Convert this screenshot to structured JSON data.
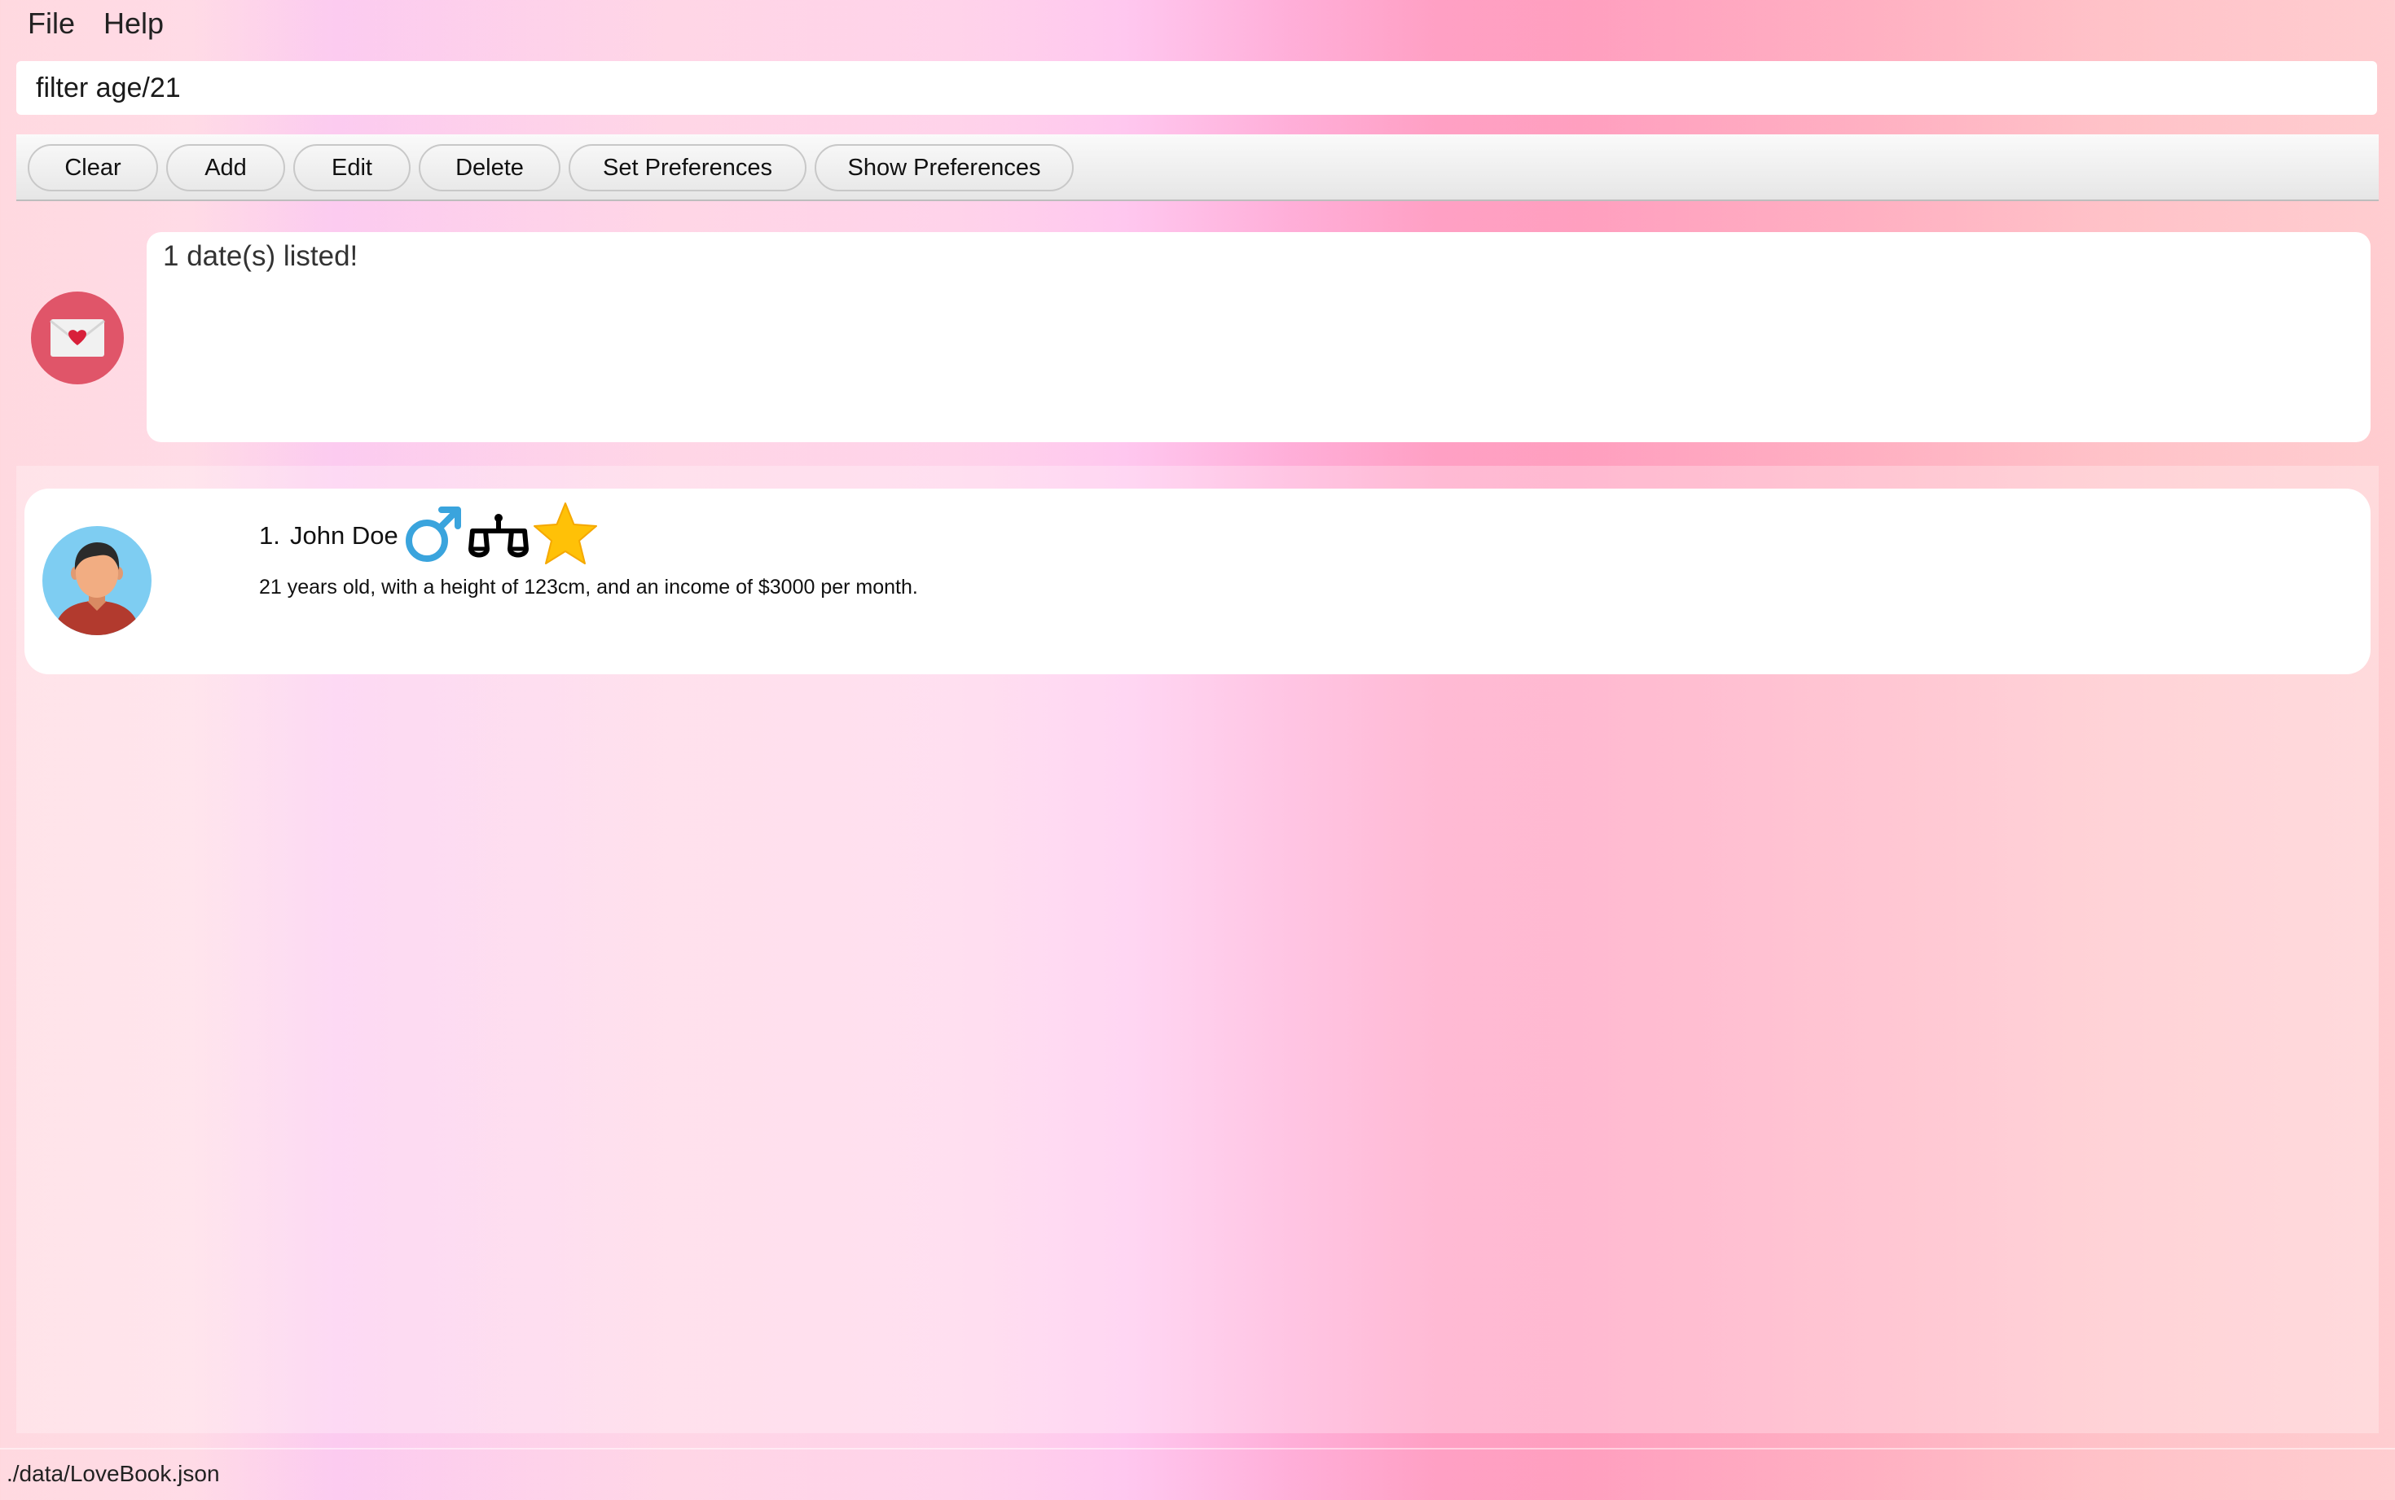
{
  "menu": {
    "file": "File",
    "help": "Help"
  },
  "command": {
    "value": "filter age/21"
  },
  "toolbar": {
    "clear": "Clear",
    "add": "Add",
    "edit": "Edit",
    "delete": "Delete",
    "set_preferences": "Set Preferences",
    "show_preferences": "Show Preferences"
  },
  "result": {
    "message": "1 date(s) listed!",
    "icon": "love-letter-icon"
  },
  "dates": [
    {
      "index": "1.",
      "name": "John Doe",
      "details": "21 years old, with a height of 123cm, and an income of $3000 per month.",
      "icons": [
        "avatar-icon",
        "male-gender-icon",
        "libra-scales-icon",
        "star-icon"
      ]
    }
  ],
  "status": {
    "file_path": "./data/LoveBook.json"
  },
  "colors": {
    "result_icon_bg": "#e05569",
    "male_icon": "#3aa4dd",
    "star_icon": "#ffc107"
  }
}
